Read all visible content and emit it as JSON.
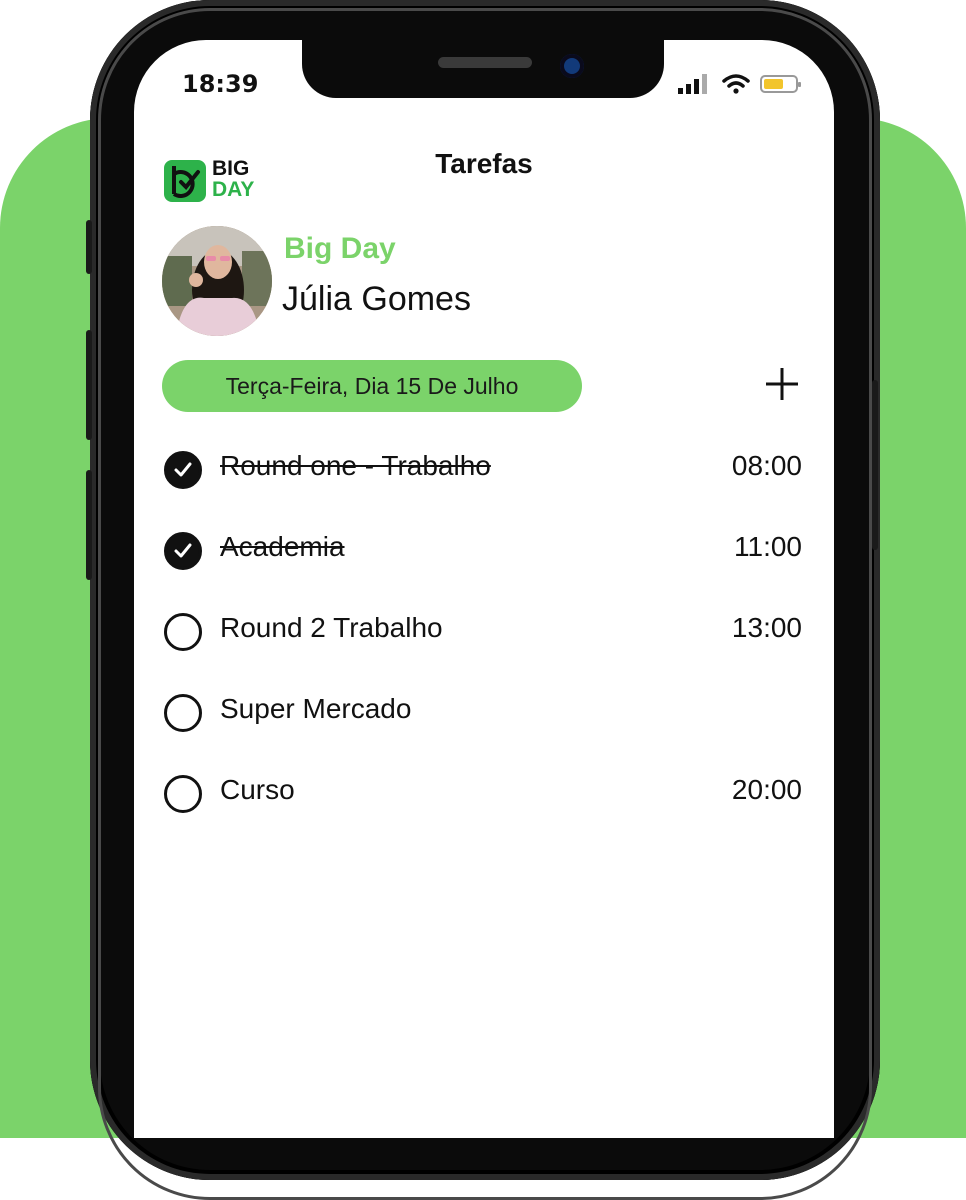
{
  "status_bar": {
    "time": "18:39"
  },
  "logo": {
    "line1": "BIG",
    "line2": "DAY"
  },
  "header": {
    "title": "Tarefas"
  },
  "profile": {
    "brand": "Big Day",
    "name": "Júlia Gomes"
  },
  "date_label": "Terça-Feira, Dia 15 De Julho",
  "tasks": [
    {
      "label": "Round one - Trabalho",
      "time": "08:00",
      "done": true
    },
    {
      "label": "Academia",
      "time": "11:00",
      "done": true
    },
    {
      "label": "Round 2 Trabalho",
      "time": "13:00",
      "done": false
    },
    {
      "label": "Super Mercado",
      "time": "",
      "done": false
    },
    {
      "label": "Curso",
      "time": "20:00",
      "done": false
    }
  ],
  "colors": {
    "accent": "#7bd36a",
    "logo_green": "#2db24a",
    "text": "#111111"
  },
  "icons": [
    "signal-icon",
    "wifi-icon",
    "battery-icon",
    "plus-icon",
    "check-icon"
  ]
}
